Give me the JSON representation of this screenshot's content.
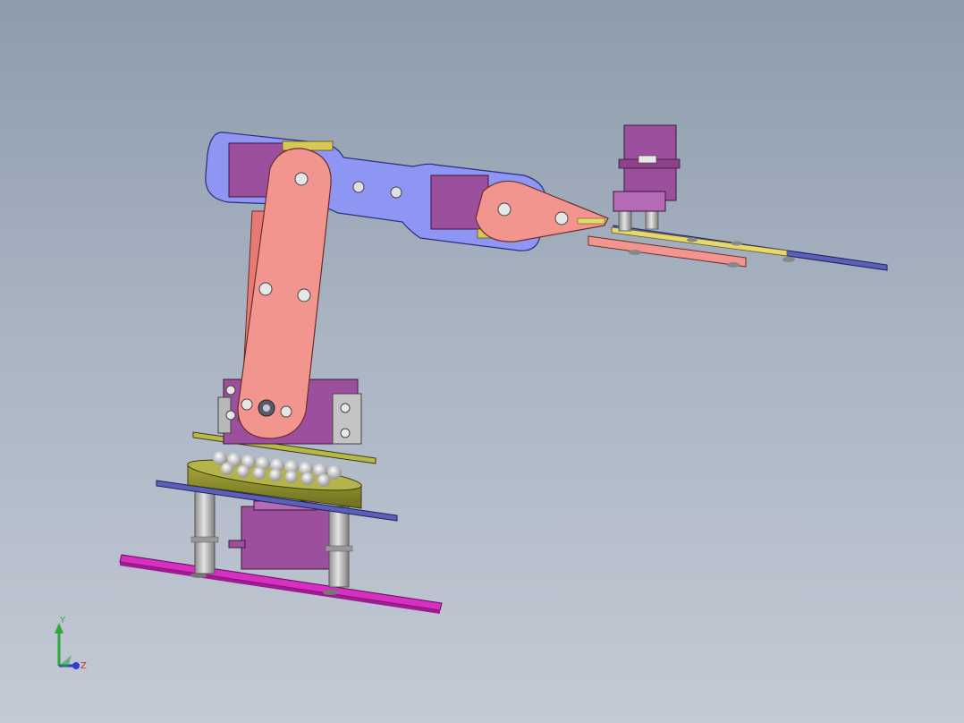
{
  "viewport": {
    "background_top": "#8d9cad",
    "background_bottom": "#c3cad5"
  },
  "model": {
    "colors": {
      "upper_arm_plate": "#8f95f2",
      "link_salmon": "#f2958e",
      "servo_purple": "#9c4f9c",
      "base_magenta": "#d62fc2",
      "bearing_olive": "#8a8a2a",
      "plate_blue": "#5a5fb8",
      "standoff_gray": "#b8b8b8"
    }
  },
  "triad": {
    "y_label": "Y",
    "z_label": "Z",
    "y_color": "#2fa83a",
    "z_color": "#2a3ec6"
  }
}
